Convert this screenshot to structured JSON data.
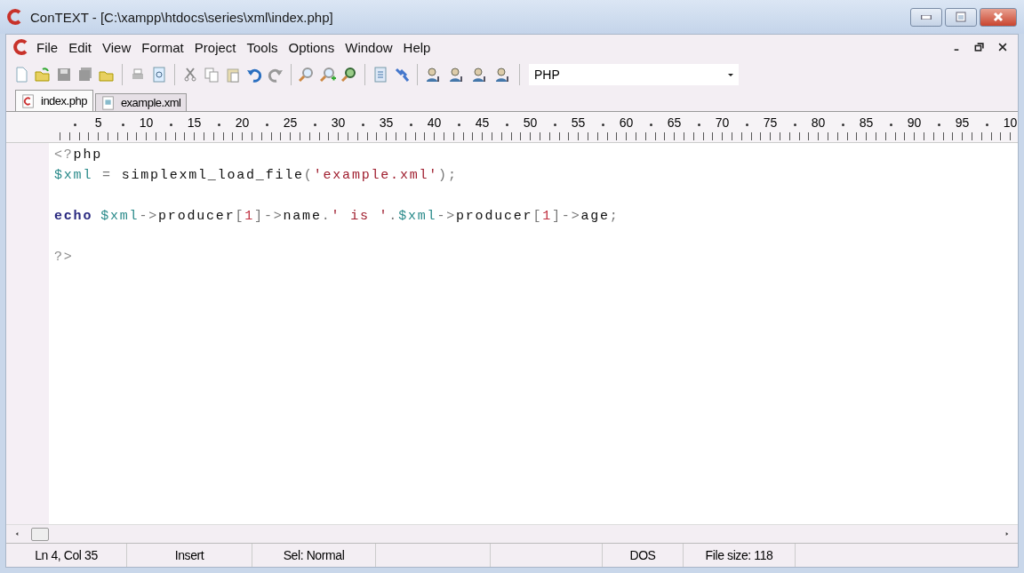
{
  "window": {
    "title": "ConTEXT - [C:\\xampp\\htdocs\\series\\xml\\index.php]"
  },
  "menu": [
    "File",
    "Edit",
    "View",
    "Format",
    "Project",
    "Tools",
    "Options",
    "Window",
    "Help"
  ],
  "toolbar": {
    "highlighter": "PHP"
  },
  "tabs": [
    {
      "label": "index.php",
      "selected": true,
      "kind": "php"
    },
    {
      "label": "example.xml",
      "selected": false,
      "kind": "xml"
    }
  ],
  "ruler": [
    "5",
    "10",
    "15",
    "20",
    "25",
    "30",
    "35",
    "40",
    "45",
    "50",
    "55",
    "60",
    "65",
    "70",
    "75",
    "80",
    "85",
    "90",
    "95",
    "10"
  ],
  "code": [
    {
      "blank_before": false,
      "tokens": [
        {
          "kind": "tag",
          "text": "<?"
        },
        {
          "kind": "ident",
          "text": "php"
        }
      ]
    },
    {
      "blank_before": false,
      "tokens": [
        {
          "kind": "var",
          "text": "$xml"
        },
        {
          "kind": "op",
          "text": " = "
        },
        {
          "kind": "ident",
          "text": "simplexml_load_file"
        },
        {
          "kind": "op",
          "text": "("
        },
        {
          "kind": "str",
          "text": "'example.xml'"
        },
        {
          "kind": "op",
          "text": ");"
        }
      ]
    },
    {
      "blank_before": true,
      "tokens": [
        {
          "kind": "kw",
          "text": "echo"
        },
        {
          "kind": "var",
          "text": "$xml"
        },
        {
          "kind": "op",
          "text": "->"
        },
        {
          "kind": "ident",
          "text": "producer"
        },
        {
          "kind": "op",
          "text": "["
        },
        {
          "kind": "num",
          "text": "1"
        },
        {
          "kind": "op",
          "text": "]->"
        },
        {
          "kind": "ident",
          "text": "name"
        },
        {
          "kind": "op",
          "text": "."
        },
        {
          "kind": "str",
          "text": "' is '"
        },
        {
          "kind": "op",
          "text": "."
        },
        {
          "kind": "var",
          "text": "$xml"
        },
        {
          "kind": "op",
          "text": "->"
        },
        {
          "kind": "ident",
          "text": "producer"
        },
        {
          "kind": "op",
          "text": "["
        },
        {
          "kind": "num",
          "text": "1"
        },
        {
          "kind": "op",
          "text": "]->"
        },
        {
          "kind": "ident",
          "text": "age"
        },
        {
          "kind": "op",
          "text": ";"
        }
      ]
    },
    {
      "blank_before": true,
      "tokens": [
        {
          "kind": "tag",
          "text": "?>"
        }
      ]
    }
  ],
  "status_bar": [
    "Ln 4, Col 35",
    "Insert",
    "Sel: Normal",
    "DOS",
    "File size: 118"
  ]
}
